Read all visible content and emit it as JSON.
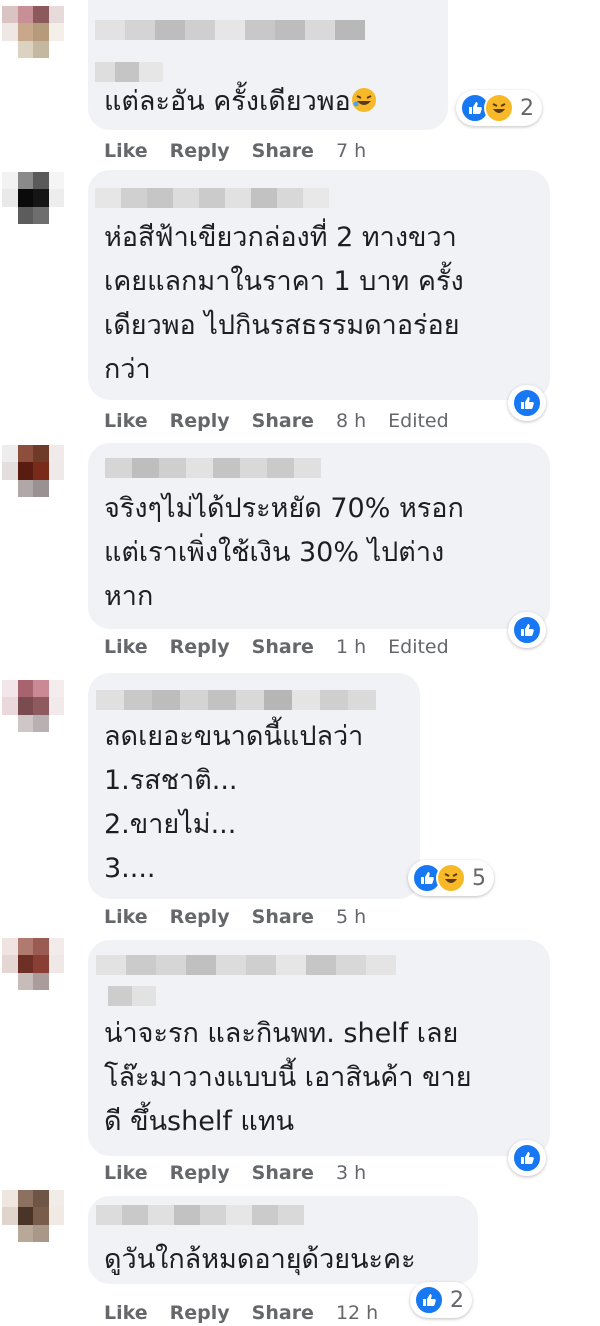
{
  "comments": [
    {
      "text": "แต่ละอัน ครั้งเดียวพอ",
      "emoji": "rofl-emoji",
      "actions": {
        "like": "Like",
        "reply": "Reply",
        "share": "Share",
        "time": "7 h"
      },
      "reactions": {
        "icons": [
          "like-icon",
          "haha-icon"
        ],
        "count": "2"
      }
    },
    {
      "text": "ห่อสีฟ้าเขียวกล่องที่ 2 ทางขวา\nเคยแลกมาในราคา 1 บาท ครั้ง\nเดียวพอ ไปกินรสธรรมดาอร่อย\nกว่า",
      "actions": {
        "like": "Like",
        "reply": "Reply",
        "share": "Share",
        "time": "8 h",
        "edited": "Edited"
      },
      "reactions": {
        "icons": [
          "like-icon"
        ]
      }
    },
    {
      "text": "จริงๆไม่ได้ประหยัด 70% หรอก\nแต่เราเพิ่งใช้เงิน 30% ไปต่าง\nหาก",
      "actions": {
        "like": "Like",
        "reply": "Reply",
        "share": "Share",
        "time": "1 h",
        "edited": "Edited"
      },
      "reactions": {
        "icons": [
          "like-icon"
        ]
      }
    },
    {
      "text": "ลดเยอะขนาดนี้แปลว่า\n1.รสชาติ...\n2.ขายไม่...\n3....",
      "actions": {
        "like": "Like",
        "reply": "Reply",
        "share": "Share",
        "time": "5 h"
      },
      "reactions": {
        "icons": [
          "like-icon",
          "haha-icon"
        ],
        "count": "5"
      }
    },
    {
      "text": "น่าจะรก และกินพท. shelf เลย\nโล๊ะมาวางแบบนี้ เอาสินค้า ขาย\nดี ขึ้นshelf แทน",
      "actions": {
        "like": "Like",
        "reply": "Reply",
        "share": "Share",
        "time": "3 h"
      },
      "reactions": {
        "icons": [
          "like-icon"
        ]
      }
    },
    {
      "text": "ดูวันใกล้หมดอายุด้วยนะคะ",
      "actions": {
        "like": "Like",
        "reply": "Reply",
        "share": "Share",
        "time": "12 h"
      },
      "reactions": {
        "icons": [
          "like-icon"
        ],
        "count": "2"
      }
    }
  ],
  "colors": {
    "bubble": "#f0f2f5",
    "meta_text": "#65676b",
    "like_blue": "#1877f2",
    "haha_yellow": "#f7b928"
  }
}
